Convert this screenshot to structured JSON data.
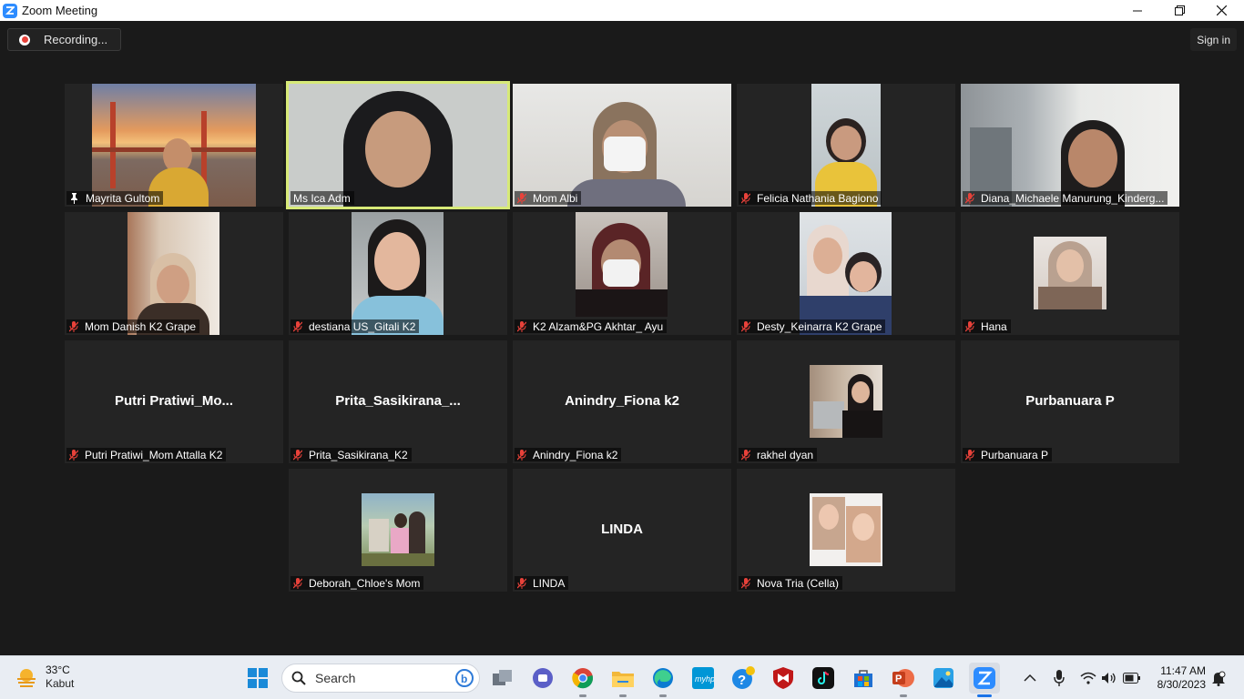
{
  "window": {
    "title": "Zoom Meeting"
  },
  "topbar": {
    "recording_label": "Recording...",
    "signin_label": "Sign in"
  },
  "participants": [
    {
      "name": "Mayrita Gultom",
      "pinned": true,
      "video": true
    },
    {
      "name": "Ms Ica Adm",
      "active_speaker": true,
      "video": true
    },
    {
      "name": "Mom Albi",
      "muted": true,
      "video": true
    },
    {
      "name": "Felicia Nathania Bagiono",
      "muted": true,
      "video": true
    },
    {
      "name": "Diana_Michaele Manurung_Kinderg...",
      "muted": true,
      "video": true
    },
    {
      "name": "Mom Danish K2 Grape",
      "muted": true,
      "video": true
    },
    {
      "name": "destiana US_Gitali K2",
      "muted": true,
      "video": true
    },
    {
      "name": "K2 Alzam&PG Akhtar_ Ayu",
      "muted": true,
      "video": true
    },
    {
      "name": "Desty_Keinarra K2 Grape",
      "muted": true,
      "video": true
    },
    {
      "name": "Hana",
      "muted": true,
      "video": true
    },
    {
      "name": "Putri Pratiwi_Mom Attalla K2",
      "display_name": "Putri  Pratiwi_Mo...",
      "muted": true,
      "video": false
    },
    {
      "name": "Prita_Sasikirana_K2",
      "display_name": "Prita_Sasikirana_...",
      "muted": true,
      "video": false
    },
    {
      "name": "Anindry_Fiona k2",
      "display_name": "Anindry_Fiona k2",
      "muted": true,
      "video": false
    },
    {
      "name": "rakhel dyan",
      "muted": true,
      "video": true
    },
    {
      "name": "Purbanuara P",
      "display_name": "Purbanuara P",
      "muted": true,
      "video": false
    },
    {
      "name": "Deborah_Chloe's Mom",
      "muted": true,
      "video": true
    },
    {
      "name": "LINDA",
      "display_name": "LINDA",
      "muted": true,
      "video": false
    },
    {
      "name": "Nova Tria (Cella)",
      "muted": true,
      "video": true
    }
  ],
  "taskbar": {
    "weather_temp": "33°C",
    "weather_condition": "Kabut",
    "search_placeholder": "Search",
    "apps": [
      "start-icon",
      "search-icon",
      "task-view-icon",
      "chat-icon",
      "chrome-icon",
      "file-explorer-icon",
      "edge-icon",
      "myhp-icon",
      "get-help-icon",
      "mcafee-icon",
      "tiktok-icon",
      "store-icon",
      "powerpoint-icon",
      "photos-icon",
      "zoom-icon"
    ],
    "time": "11:47 AM",
    "date": "8/30/2023"
  },
  "colors": {
    "active_speaker_border": "#d7ea78",
    "zoom_blue": "#2d8cff",
    "mute_red": "#e8423a",
    "tile_bg": "#242424"
  }
}
